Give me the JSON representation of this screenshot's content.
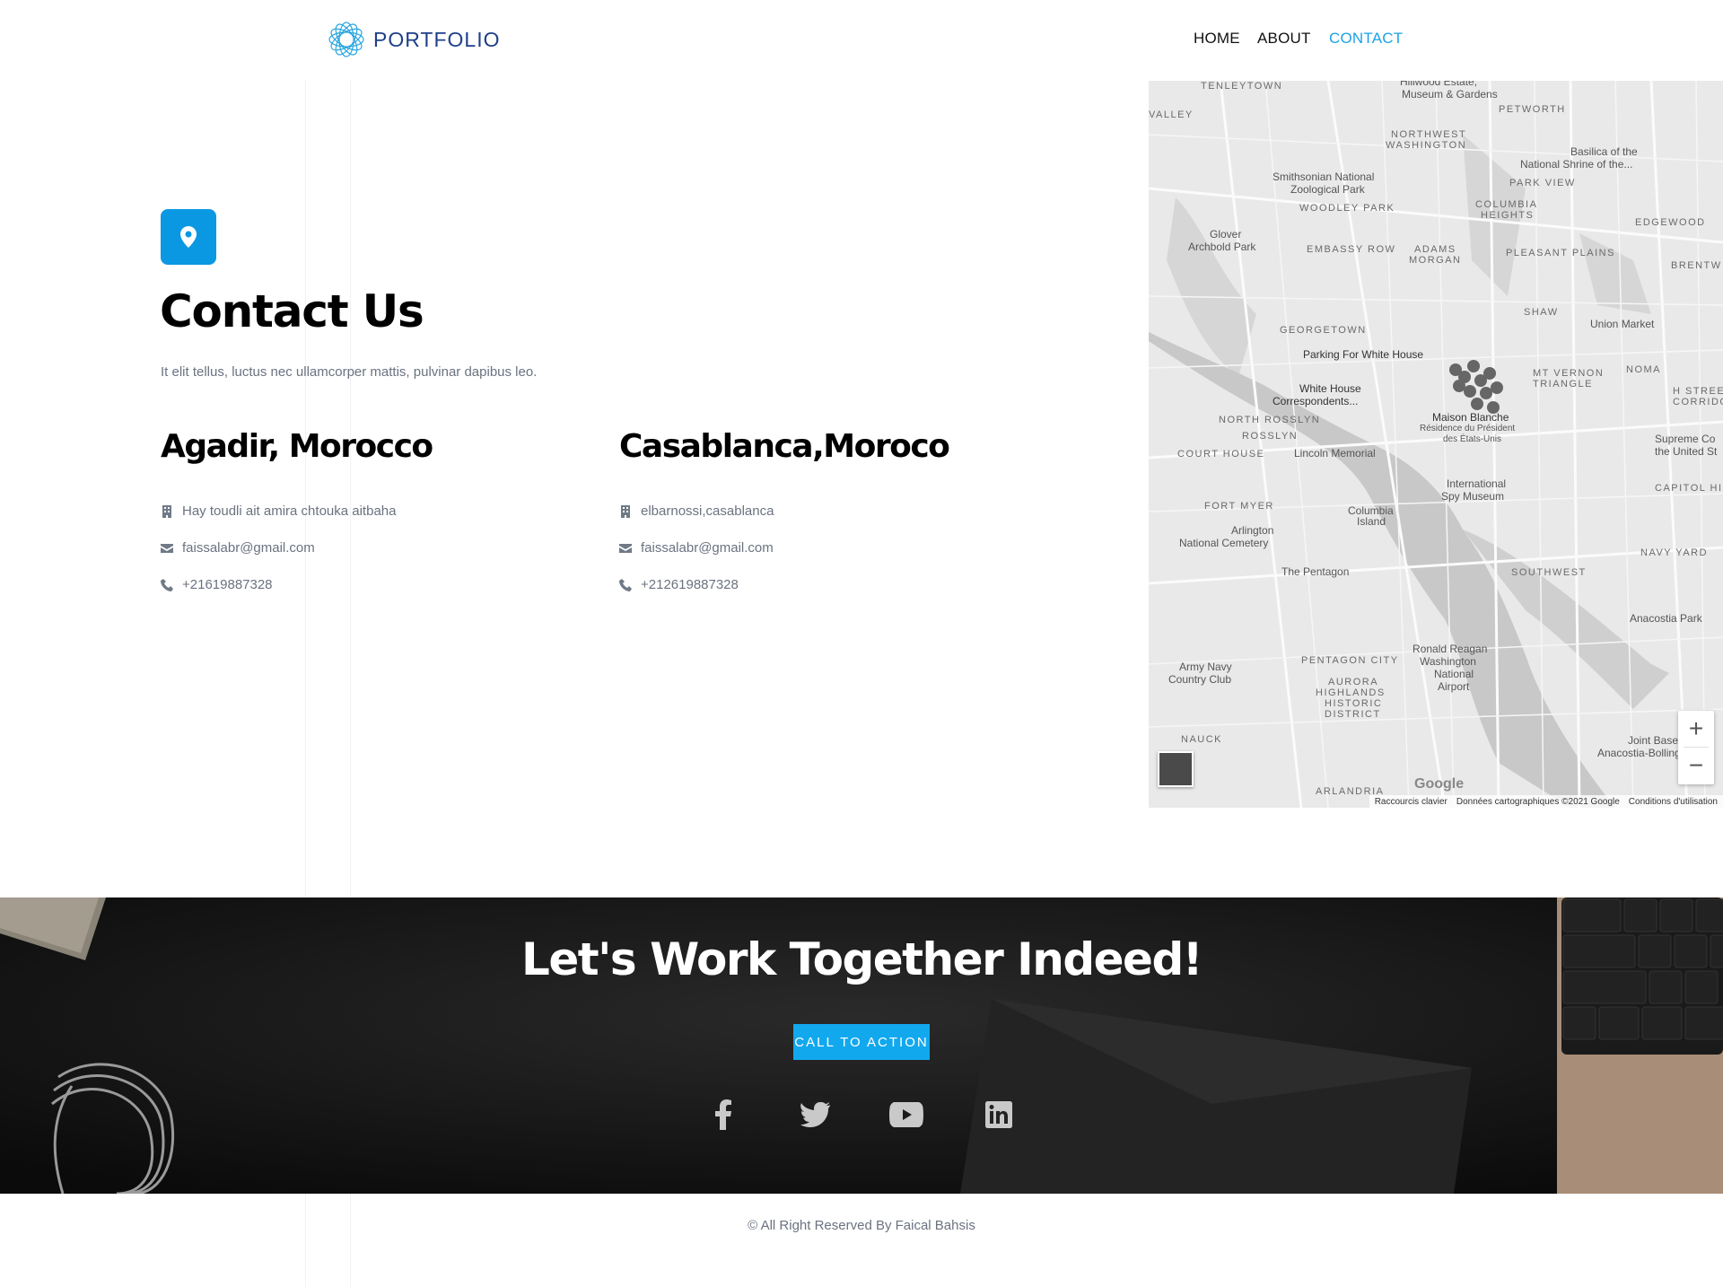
{
  "header": {
    "logo_text": "PORTFOLIO",
    "nav": [
      {
        "label": "HOME",
        "active": false
      },
      {
        "label": "ABOUT",
        "active": false
      },
      {
        "label": "CONTACT",
        "active": true
      }
    ]
  },
  "contact": {
    "icon": "location-pin-icon",
    "title": "Contact Us",
    "subtitle": "It elit tellus, luctus nec ullamcorper mattis, pulvinar dapibus leo.",
    "offices": [
      {
        "city": "Agadir, Morocco",
        "address": "Hay toudli ait amira chtouka aitbaha",
        "email": "faissalabr@gmail.com",
        "phone": "+21619887328"
      },
      {
        "city": "Casablanca,Moroco",
        "address": "elbarnossi,casablanca",
        "email": "faissalabr@gmail.com",
        "phone": "+212619887328"
      }
    ]
  },
  "map": {
    "labels": {
      "tenleytown": "TENLEYTOWN",
      "hillwood": "Hillwood Estate,",
      "hillwood2": "Museum & Gardens",
      "petworth": "PETWORTH",
      "valley": "VALLEY",
      "nw_washington": "NORTHWEST",
      "nw_washington2": "WASHINGTON",
      "basilica": "Basilica of the",
      "basilica2": "National Shrine of the...",
      "park_view": "PARK VIEW",
      "zoo": "Smithsonian National",
      "zoo2": "Zoological Park",
      "woodley": "WOODLEY PARK",
      "columbia_heights": "COLUMBIA",
      "columbia_heights2": "HEIGHTS",
      "edgewood": "EDGEWOOD",
      "glover": "Glover",
      "glover2": "Archbold Park",
      "embassy": "EMBASSY ROW",
      "adams": "ADAMS",
      "adams2": "MORGAN",
      "pleasant": "PLEASANT PLAINS",
      "brentw": "BRENTW",
      "georgetown": "GEORGETOWN",
      "shaw": "SHAW",
      "union": "Union Market",
      "parking": "Parking For White House",
      "white_house_corr": "White House",
      "white_house_corr2": "Correspondents...",
      "mt_vernon": "MT VERNON",
      "mt_vernon2": "TRIANGLE",
      "noma": "NOMA",
      "h_street": "H STREET",
      "h_street2": "CORRIDOR",
      "maison": "Maison Blanche",
      "maison2": "Résidence du Président",
      "maison3": "des États-Unis",
      "north_rosslyn": "NORTH ROSSLYN",
      "rosslyn": "ROSSLYN",
      "court_house": "COURT HOUSE",
      "lincoln": "Lincoln Memorial",
      "supreme": "Supreme Co",
      "supreme2": "the United St",
      "spy": "International",
      "spy2": "Spy Museum",
      "capitol": "CAPITOL HILL",
      "fort_myer": "FORT MYER",
      "columbia_island": "Columbia",
      "columbia_island2": "Island",
      "arlington": "Arlington",
      "arlington2": "National Cemetery",
      "navy_yard": "NAVY YARD",
      "pentagon": "The Pentagon",
      "southwest": "SOUTHWEST",
      "anacostia_park": "Anacostia Park",
      "army_navy": "Army Navy",
      "army_navy2": "Country Club",
      "pentagon_city": "PENTAGON CITY",
      "reagan": "Ronald Reagan",
      "reagan2": "Washington",
      "reagan3": "National",
      "reagan4": "Airport",
      "aurora": "AURORA",
      "aurora2": "HIGHLANDS",
      "aurora3": "HISTORIC",
      "aurora4": "DISTRICT",
      "nauck": "NAUCK",
      "joint_base": "Joint Base",
      "joint_base2": "Anacostia-Bolling",
      "arlandria": "ARLANDRIA",
      "google": "Google"
    },
    "zoom_in": "+",
    "zoom_out": "−",
    "footer": {
      "shortcuts": "Raccourcis clavier",
      "data": "Données cartographiques ©2021 Google",
      "terms": "Conditions d'utilisation"
    }
  },
  "cta": {
    "title": "Let's Work Together Indeed!",
    "button": "CALL TO ACTION",
    "social": [
      "facebook-icon",
      "twitter-icon",
      "youtube-icon",
      "linkedin-icon"
    ]
  },
  "footer": {
    "copyright": "© All Right Reserved By Faical Bahsis"
  }
}
